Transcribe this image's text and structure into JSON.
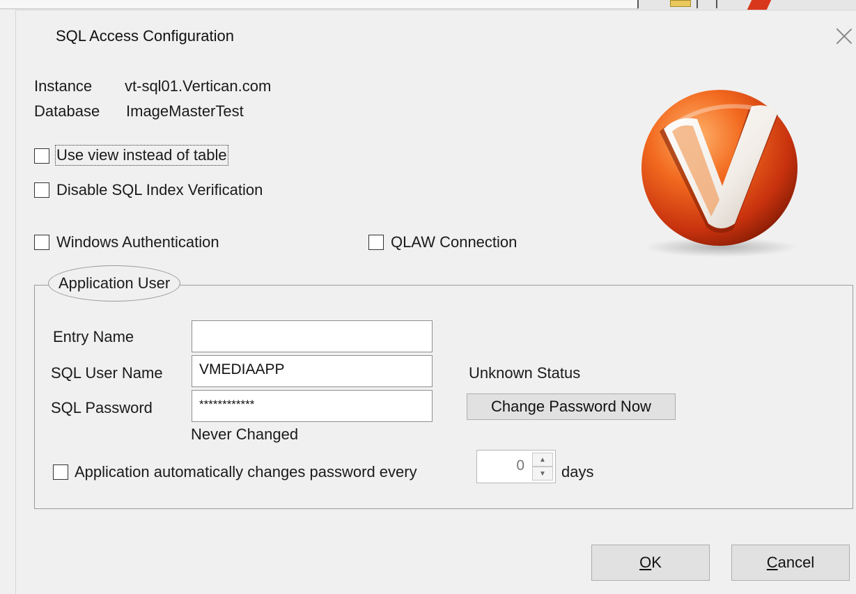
{
  "window": {
    "title": "SQL Access Configuration"
  },
  "info": {
    "instance_label": "Instance",
    "instance_value": "vt-sql01.Vertican.com",
    "database_label": "Database",
    "database_value": "ImageMasterTest"
  },
  "options": {
    "use_view": {
      "label": "Use view instead of table",
      "checked": false
    },
    "disable_index": {
      "label": "Disable SQL Index Verification",
      "checked": false
    },
    "windows_auth": {
      "label": "Windows Authentication",
      "checked": false
    },
    "qlaw": {
      "label": "QLAW Connection",
      "checked": false
    }
  },
  "app_user": {
    "legend": "Application User",
    "entry_name_label": "Entry Name",
    "entry_name_value": "",
    "sql_user_label": "SQL User Name",
    "sql_user_value": "VMEDIAAPP",
    "sql_password_label": "SQL Password",
    "sql_password_value": "************",
    "status_text": "Unknown Status",
    "change_password_button": "Change Password Now",
    "never_changed_text": "Never Changed",
    "auto_change_label": "Application automatically changes password every",
    "auto_change_checked": false,
    "days_value": "0",
    "days_label": "days"
  },
  "buttons": {
    "ok_mnemonic": "O",
    "ok_rest": "K",
    "cancel_mnemonic": "C",
    "cancel_rest": "ancel"
  },
  "icons": {
    "close": "close-icon",
    "logo": "vertican-v-logo",
    "spin_up": "chevron-up-icon",
    "spin_down": "chevron-down-icon"
  }
}
